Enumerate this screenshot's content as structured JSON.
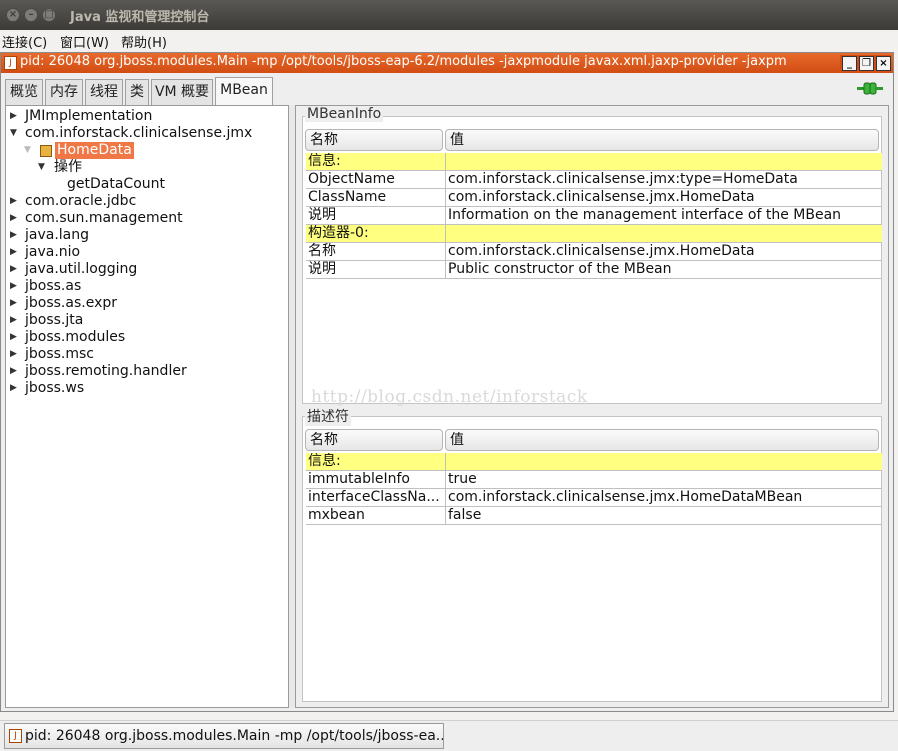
{
  "window": {
    "title": "Java 监视和管理控制台"
  },
  "menubar": {
    "items": [
      "连接(C)",
      "窗口(W)",
      "帮助(H)"
    ]
  },
  "internal_frame": {
    "title": "pid: 26048 org.jboss.modules.Main -mp /opt/tools/jboss-eap-6.2/modules -jaxpmodule javax.xml.jaxp-provider -jaxpm"
  },
  "tabs": [
    "概览",
    "内存",
    "线程",
    "类",
    "VM 概要",
    "MBean"
  ],
  "active_tab": "MBean",
  "tree": {
    "nodes": [
      "JMImplementation",
      "com.inforstack.clinicalsense.jmx",
      "HomeData",
      "操作",
      "getDataCount",
      "com.oracle.jdbc",
      "com.sun.management",
      "java.lang",
      "java.nio",
      "java.util.logging",
      "jboss.as",
      "jboss.as.expr",
      "jboss.jta",
      "jboss.modules",
      "jboss.msc",
      "jboss.remoting.handler",
      "jboss.ws"
    ],
    "selected": "HomeData"
  },
  "mbeaninfo": {
    "title": "MBeanInfo",
    "columns": [
      "名称",
      "值"
    ],
    "rows": [
      [
        "信息:",
        ""
      ],
      [
        "ObjectName",
        "com.inforstack.clinicalsense.jmx:type=HomeData"
      ],
      [
        "ClassName",
        "com.inforstack.clinicalsense.jmx.HomeData"
      ],
      [
        "说明",
        "Information on the management interface of the MBean"
      ],
      [
        "构造器-0:",
        ""
      ],
      [
        "名称",
        "com.inforstack.clinicalsense.jmx.HomeData"
      ],
      [
        "说明",
        "Public constructor of the MBean"
      ]
    ],
    "watermark": "http://blog.csdn.net/inforstack"
  },
  "descriptor": {
    "title": "描述符",
    "columns": [
      "名称",
      "值"
    ],
    "rows": [
      [
        "信息:",
        ""
      ],
      [
        "immutableInfo",
        "true"
      ],
      [
        "interfaceClassNa...",
        "com.inforstack.clinicalsense.jmx.HomeDataMBean"
      ],
      [
        "mxbean",
        "false"
      ]
    ]
  },
  "taskbar": {
    "task_label": "pid: 26048 org.jboss.modules.Main -mp /opt/tools/jboss-ea..."
  },
  "colors": {
    "accent": "#e0581e",
    "selection": "#f07746",
    "highlight_row": "#ffff80"
  }
}
